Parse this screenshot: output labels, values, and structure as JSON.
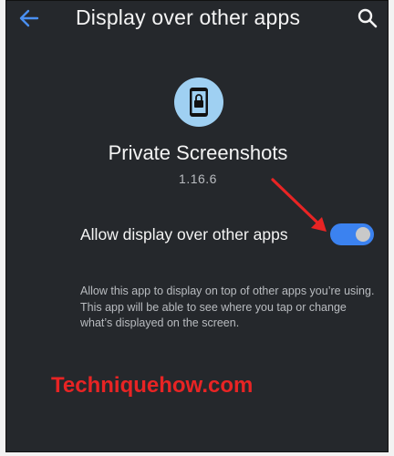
{
  "header": {
    "title": "Display over other apps",
    "back_icon": "back-arrow-icon",
    "search_icon": "search-icon"
  },
  "app": {
    "icon": "phone-lock-icon",
    "name": "Private Screenshots",
    "version": "1.16.6"
  },
  "permission": {
    "label": "Allow display over other apps",
    "enabled": true,
    "description": "Allow this app to display on top of other apps you’re using. This app will be able to see where you tap or change what’s displayed on the screen."
  },
  "watermark": "Techniquehow.com",
  "colors": {
    "background": "#25282c",
    "accent": "#3b82f0",
    "icon_circle": "#9fd0f2",
    "annotation": "#e82424"
  }
}
